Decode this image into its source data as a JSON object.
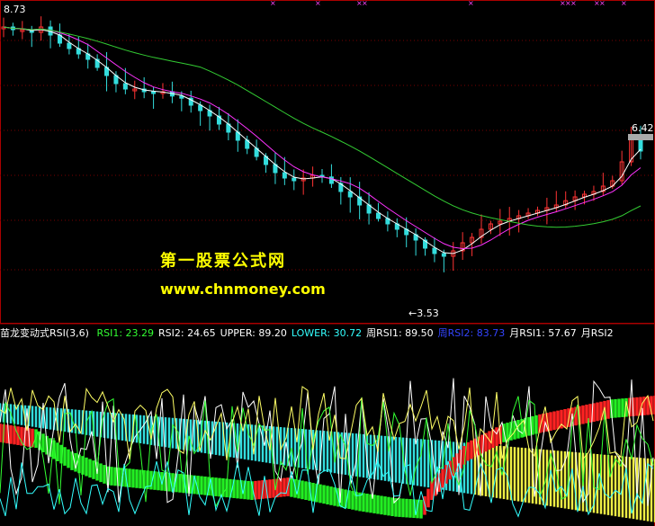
{
  "chart_data": [
    {
      "type": "candlestick",
      "panel": "price",
      "price_range": [
        3.0,
        9.0
      ],
      "high_label": "8.73",
      "low_label": "3.53",
      "last_price_label": "6.42",
      "ma_colors": [
        "#ffffff",
        "#ff33ff",
        "#33cc33"
      ],
      "closes": [
        8.5,
        8.45,
        8.45,
        8.4,
        8.5,
        8.35,
        8.2,
        8.1,
        8.0,
        7.9,
        7.75,
        7.6,
        7.45,
        7.35,
        7.35,
        7.3,
        7.28,
        7.3,
        7.22,
        7.18,
        7.05,
        6.95,
        6.85,
        6.7,
        6.55,
        6.4,
        6.25,
        6.1,
        5.95,
        5.8,
        5.7,
        5.65,
        5.7,
        5.75,
        5.72,
        5.6,
        5.45,
        5.35,
        5.2,
        5.05,
        4.95,
        4.85,
        4.75,
        4.65,
        4.55,
        4.4,
        4.3,
        4.25,
        4.35,
        4.5,
        4.6,
        4.75,
        4.85,
        4.9,
        4.95,
        5.0,
        5.05,
        5.1,
        5.15,
        5.2,
        5.28,
        5.35,
        5.4,
        5.45,
        5.55,
        5.65,
        6.0,
        6.5,
        6.2
      ]
    },
    {
      "type": "rsi-bars",
      "panel": "indicator",
      "title": "苗龙变动式RSI(3,6)",
      "legend": [
        {
          "label": "RSI1: 23.29",
          "color": "#33ff33"
        },
        {
          "label": "RSI2: 24.65",
          "color": "#ffffff"
        },
        {
          "label": "UPPER: 89.20",
          "color": "#ffffff"
        },
        {
          "label": "LOWER: 30.72",
          "color": "#33ffff"
        },
        {
          "label": "周RSI1: 89.50",
          "color": "#ffffff"
        },
        {
          "label": "周RSI2: 83.73",
          "color": "#3344ff"
        },
        {
          "label": "月RSI1: 57.67",
          "color": "#ffffff"
        },
        {
          "label": "月RSI2",
          "color": "#ffffff"
        }
      ],
      "band_colors": {
        "upper_band": "#33dddd",
        "upper_band_late": "#eeee44",
        "lower_band_down": "#22ee22",
        "lower_band_up": "#ff2222"
      }
    }
  ],
  "watermark": {
    "line1": "第一股票公式网",
    "line2": "www.chnmoney.com",
    "color": "#ffff00"
  }
}
